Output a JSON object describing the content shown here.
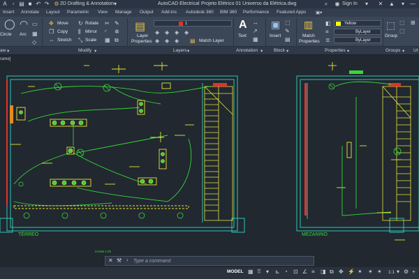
{
  "titlebar": {
    "workspace": "2D Drafting & Annotation",
    "app_title": "AutoCAD Electrical",
    "file_title": "Projeto Elétrico 01 Universo da Elétrica.dwg",
    "sign_in": "Sign In"
  },
  "tabs": [
    "Insert",
    "Annotate",
    "Layout",
    "Parametric",
    "View",
    "Manage",
    "Output",
    "Add-ins",
    "Autodesk 360",
    "BIM 360",
    "Performance",
    "Featured Apps"
  ],
  "ribbon": {
    "draw": {
      "circle": "Circle",
      "arc": "Arc"
    },
    "modify": {
      "move": "Move",
      "rotate": "Rotate",
      "copy": "Copy",
      "mirror": "Mirror",
      "stretch": "Stretch",
      "scale": "Scale"
    },
    "layers": {
      "layer_properties_1": "Layer",
      "layer_properties_2": "Properties",
      "layer_value": "1",
      "match_layer": "Match Layer"
    },
    "annotation": {
      "text": "Text"
    },
    "block": {
      "insert": "Insert"
    },
    "properties": {
      "match_1": "Match",
      "match_2": "Properties",
      "color": "Yellow",
      "linetype": "ByLayer",
      "lineweight": "ByLayer",
      "color_hex": "#ffff00"
    },
    "groups": {
      "group": "Group"
    }
  },
  "panels": {
    "draw": "aw",
    "modify": "Modify",
    "layers": "Layers",
    "annotation": "Annotation",
    "block": "Block",
    "properties": "Properties",
    "groups": "Groups"
  },
  "drawing": {
    "file_tab": "rame]",
    "label_terreo": "TÉRREO",
    "label_mezanino": "MEZANINO",
    "scale_note": "escala 1:25"
  },
  "command_line": {
    "placeholder": "Type a command"
  },
  "status": {
    "model": "MODEL",
    "scale": "1:1"
  },
  "colors": {
    "background": "#212830",
    "wall": "#2fc6b6",
    "wiring": "#39d63a",
    "fixtures": "#e6e63a",
    "accent_red": "#e0332e",
    "label": "#3ad63a"
  }
}
